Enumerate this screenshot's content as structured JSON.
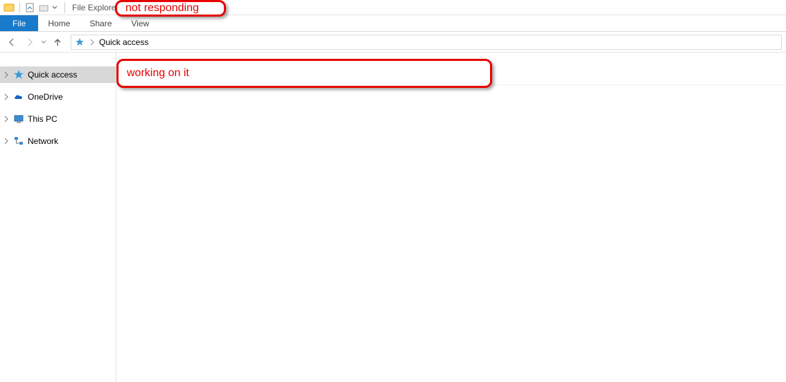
{
  "titlebar": {
    "app_name": "File Explorer"
  },
  "ribbon": {
    "file": "File",
    "home": "Home",
    "share": "Share",
    "view": "View"
  },
  "addressbar": {
    "location": "Quick access"
  },
  "sidebar": {
    "items": [
      {
        "label": "Quick access"
      },
      {
        "label": "OneDrive"
      },
      {
        "label": "This PC"
      },
      {
        "label": "Network"
      }
    ]
  },
  "annotations": {
    "not_responding": "not responding",
    "working_on_it": "working on it"
  }
}
